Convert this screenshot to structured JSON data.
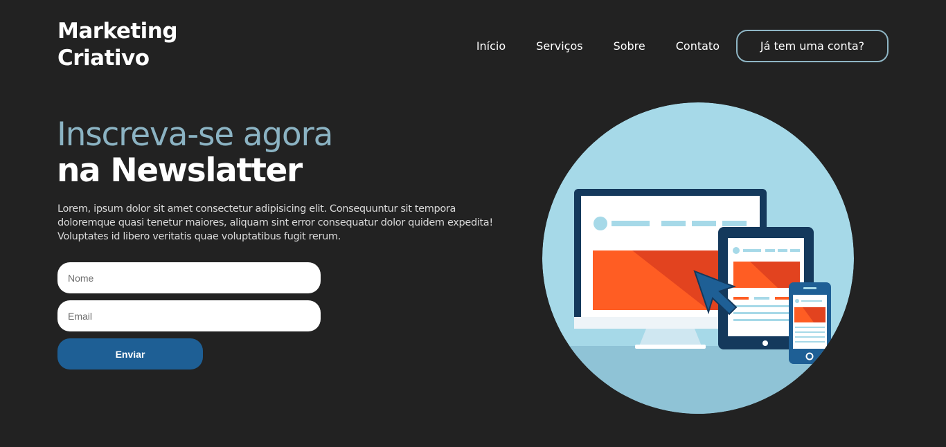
{
  "header": {
    "logo_line1": "Marketing",
    "logo_line2": "Criativo",
    "nav": [
      {
        "label": "Início"
      },
      {
        "label": "Serviços"
      },
      {
        "label": "Sobre"
      },
      {
        "label": "Contato"
      }
    ],
    "account_button": "Já tem uma conta?"
  },
  "hero": {
    "title_line1": "Inscreva-se agora",
    "title_line2": "na Newslatter",
    "description": "Lorem, ipsum dolor sit amet consectetur adipisicing elit. Consequuntur sit tempora doloremque quasi tenetur maiores, aliquam sint error consequatur dolor quidem expedita! Voluptates id libero veritatis quae voluptatibus fugit rerum."
  },
  "form": {
    "name_placeholder": "Nome",
    "email_placeholder": "Email",
    "submit_label": "Enviar"
  },
  "colors": {
    "background": "#222222",
    "title_accent": "#8bb3c3",
    "button_border": "#8fb6c5",
    "submit": "#1e5f95",
    "illustration_circle": "#a6d9e8",
    "illustration_orange": "#ff5d23",
    "illustration_navy": "#14395c"
  },
  "illustration": {
    "icon": "responsive-devices-illustration"
  }
}
